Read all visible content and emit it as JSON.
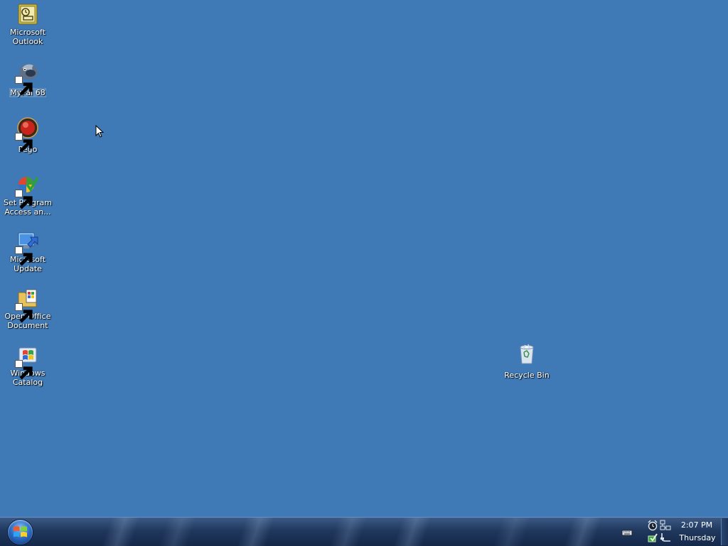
{
  "desktop": {
    "background_color": "#3f7ab7",
    "icons": [
      {
        "label_line1": "Microsoft",
        "label_line2": "Outlook",
        "icon": "outlook-icon",
        "shortcut": false
      },
      {
        "label_line1": "MyPal 68",
        "label_line2": "",
        "icon": "mypal-browser-icon",
        "shortcut": true,
        "selected": true
      },
      {
        "label_line1": "Pego",
        "label_line2": "",
        "icon": "pego-icon",
        "shortcut": true
      },
      {
        "label_line1": "Set Program",
        "label_line2": "Access an...",
        "icon": "set-program-access-icon",
        "shortcut": true
      },
      {
        "label_line1": "Microsoft",
        "label_line2": "Update",
        "icon": "microsoft-update-icon",
        "shortcut": true
      },
      {
        "label_line1": "Open Office",
        "label_line2": "Document",
        "icon": "open-office-document-icon",
        "shortcut": true
      },
      {
        "label_line1": "Windows",
        "label_line2": "Catalog",
        "icon": "windows-catalog-icon",
        "shortcut": true
      }
    ],
    "recycle_bin": {
      "label": "Recycle Bin",
      "icon": "recycle-bin-icon"
    }
  },
  "taskbar": {
    "start_button": {
      "icon": "windows-start-orb-icon"
    },
    "tray": {
      "icons": [
        "keyboard-icon",
        "alarm-clock-icon",
        "network-icon",
        "safely-remove-icon",
        "power-plug-icon"
      ],
      "time": "2:07 PM",
      "day": "Thursday"
    }
  }
}
